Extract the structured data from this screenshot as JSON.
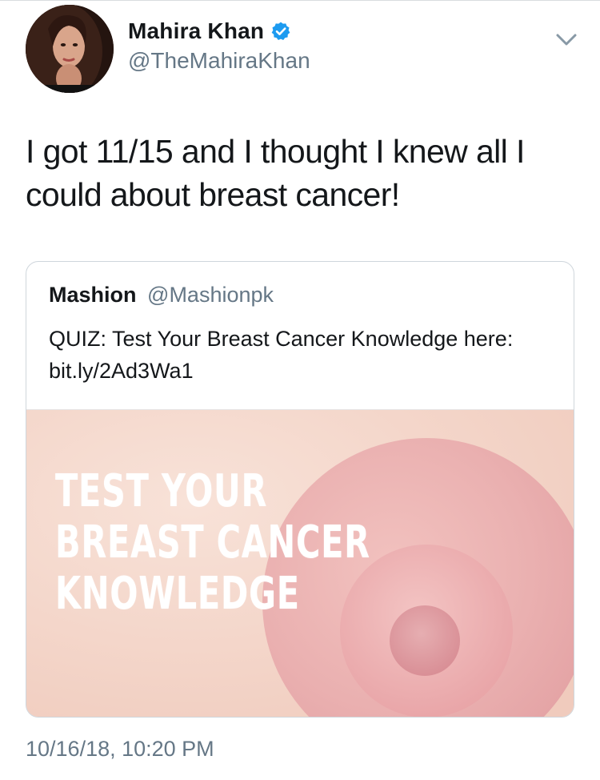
{
  "tweet": {
    "author": {
      "display_name": "Mahira Khan",
      "handle": "@TheMahiraKhan",
      "verified": true
    },
    "text": "I got 11/15 and I thought I knew all I\ncould about breast cancer!",
    "timestamp": "10/16/18, 10:20 PM"
  },
  "quote": {
    "author_name": "Mashion",
    "author_handle": "@Mashionpk",
    "text": "QUIZ: Test Your Breast Cancer Knowledge here: bit.ly/2Ad3Wa1",
    "media": {
      "title_lines": [
        "TEST YOUR",
        "BREAST CANCER",
        "KNOWLEDGE"
      ]
    }
  },
  "icons": {
    "verified": "verified-badge-icon",
    "menu": "chevron-down-icon"
  },
  "colors": {
    "primary_text": "#14171a",
    "secondary_text": "#657786",
    "verified_blue": "#1d9bf0",
    "card_border": "#cfd6dc",
    "media_background": "#f4d6cb",
    "media_circle": "#e9a5a7"
  }
}
